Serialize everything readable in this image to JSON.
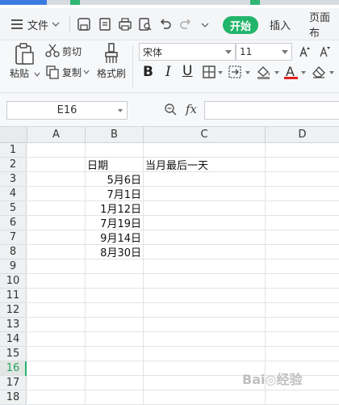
{
  "menubar": {
    "file_label": "文件",
    "tabs": [
      {
        "label": "开始",
        "active": true
      },
      {
        "label": "插入",
        "active": false
      },
      {
        "label": "页面布",
        "active": false
      }
    ]
  },
  "ribbon": {
    "paste_label": "粘贴",
    "cut_label": "剪切",
    "copy_label": "复制",
    "format_painter_label": "格式刷",
    "font_name": "宋体",
    "font_size": "11",
    "accent_color": "#23b46b",
    "font_color": "#e02020"
  },
  "formula_bar": {
    "name_box": "E16",
    "fx_label": "fx",
    "formula_value": ""
  },
  "sheet": {
    "columns": [
      "A",
      "B",
      "C",
      "D"
    ],
    "rows": [
      "1",
      "2",
      "3",
      "4",
      "5",
      "6",
      "7",
      "8",
      "9",
      "10",
      "11",
      "12",
      "13",
      "14",
      "15",
      "16",
      "17",
      "18"
    ],
    "active_row": "16",
    "header_row": {
      "b": "日期",
      "c": "当月最后一天"
    },
    "dates": [
      "5月6日",
      "7月1日",
      "1月12日",
      "7月19日",
      "9月14日",
      "8月30日"
    ]
  }
}
